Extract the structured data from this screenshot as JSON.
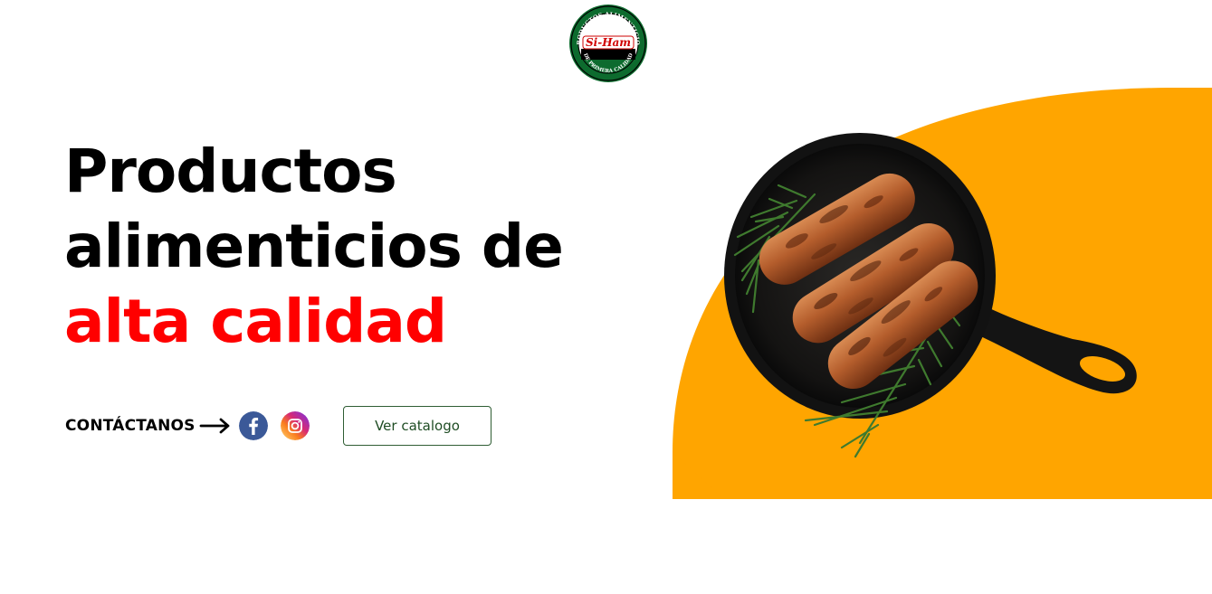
{
  "brand": {
    "logo_text": "Si-Ham",
    "logo_ring_text": "PRODUCTOS ALIMENTICIOS DE PRIMERA CALIDAD"
  },
  "hero": {
    "headline_line1": "Productos",
    "headline_line2": "alimenticios de",
    "headline_accent": "alta calidad"
  },
  "contact": {
    "label": "CONTÁCTANOS",
    "arrow_icon": "arrow-right-icon",
    "social": [
      {
        "name": "facebook-icon",
        "glyph": "f"
      },
      {
        "name": "instagram-icon"
      }
    ]
  },
  "cta": {
    "catalog_label": "Ver catalogo"
  },
  "colors": {
    "accent_red": "#ff0000",
    "accent_orange": "#ffa500",
    "button_green": "#2f5d34",
    "facebook_blue": "#3b5998",
    "logo_green": "#0d6b2e"
  }
}
